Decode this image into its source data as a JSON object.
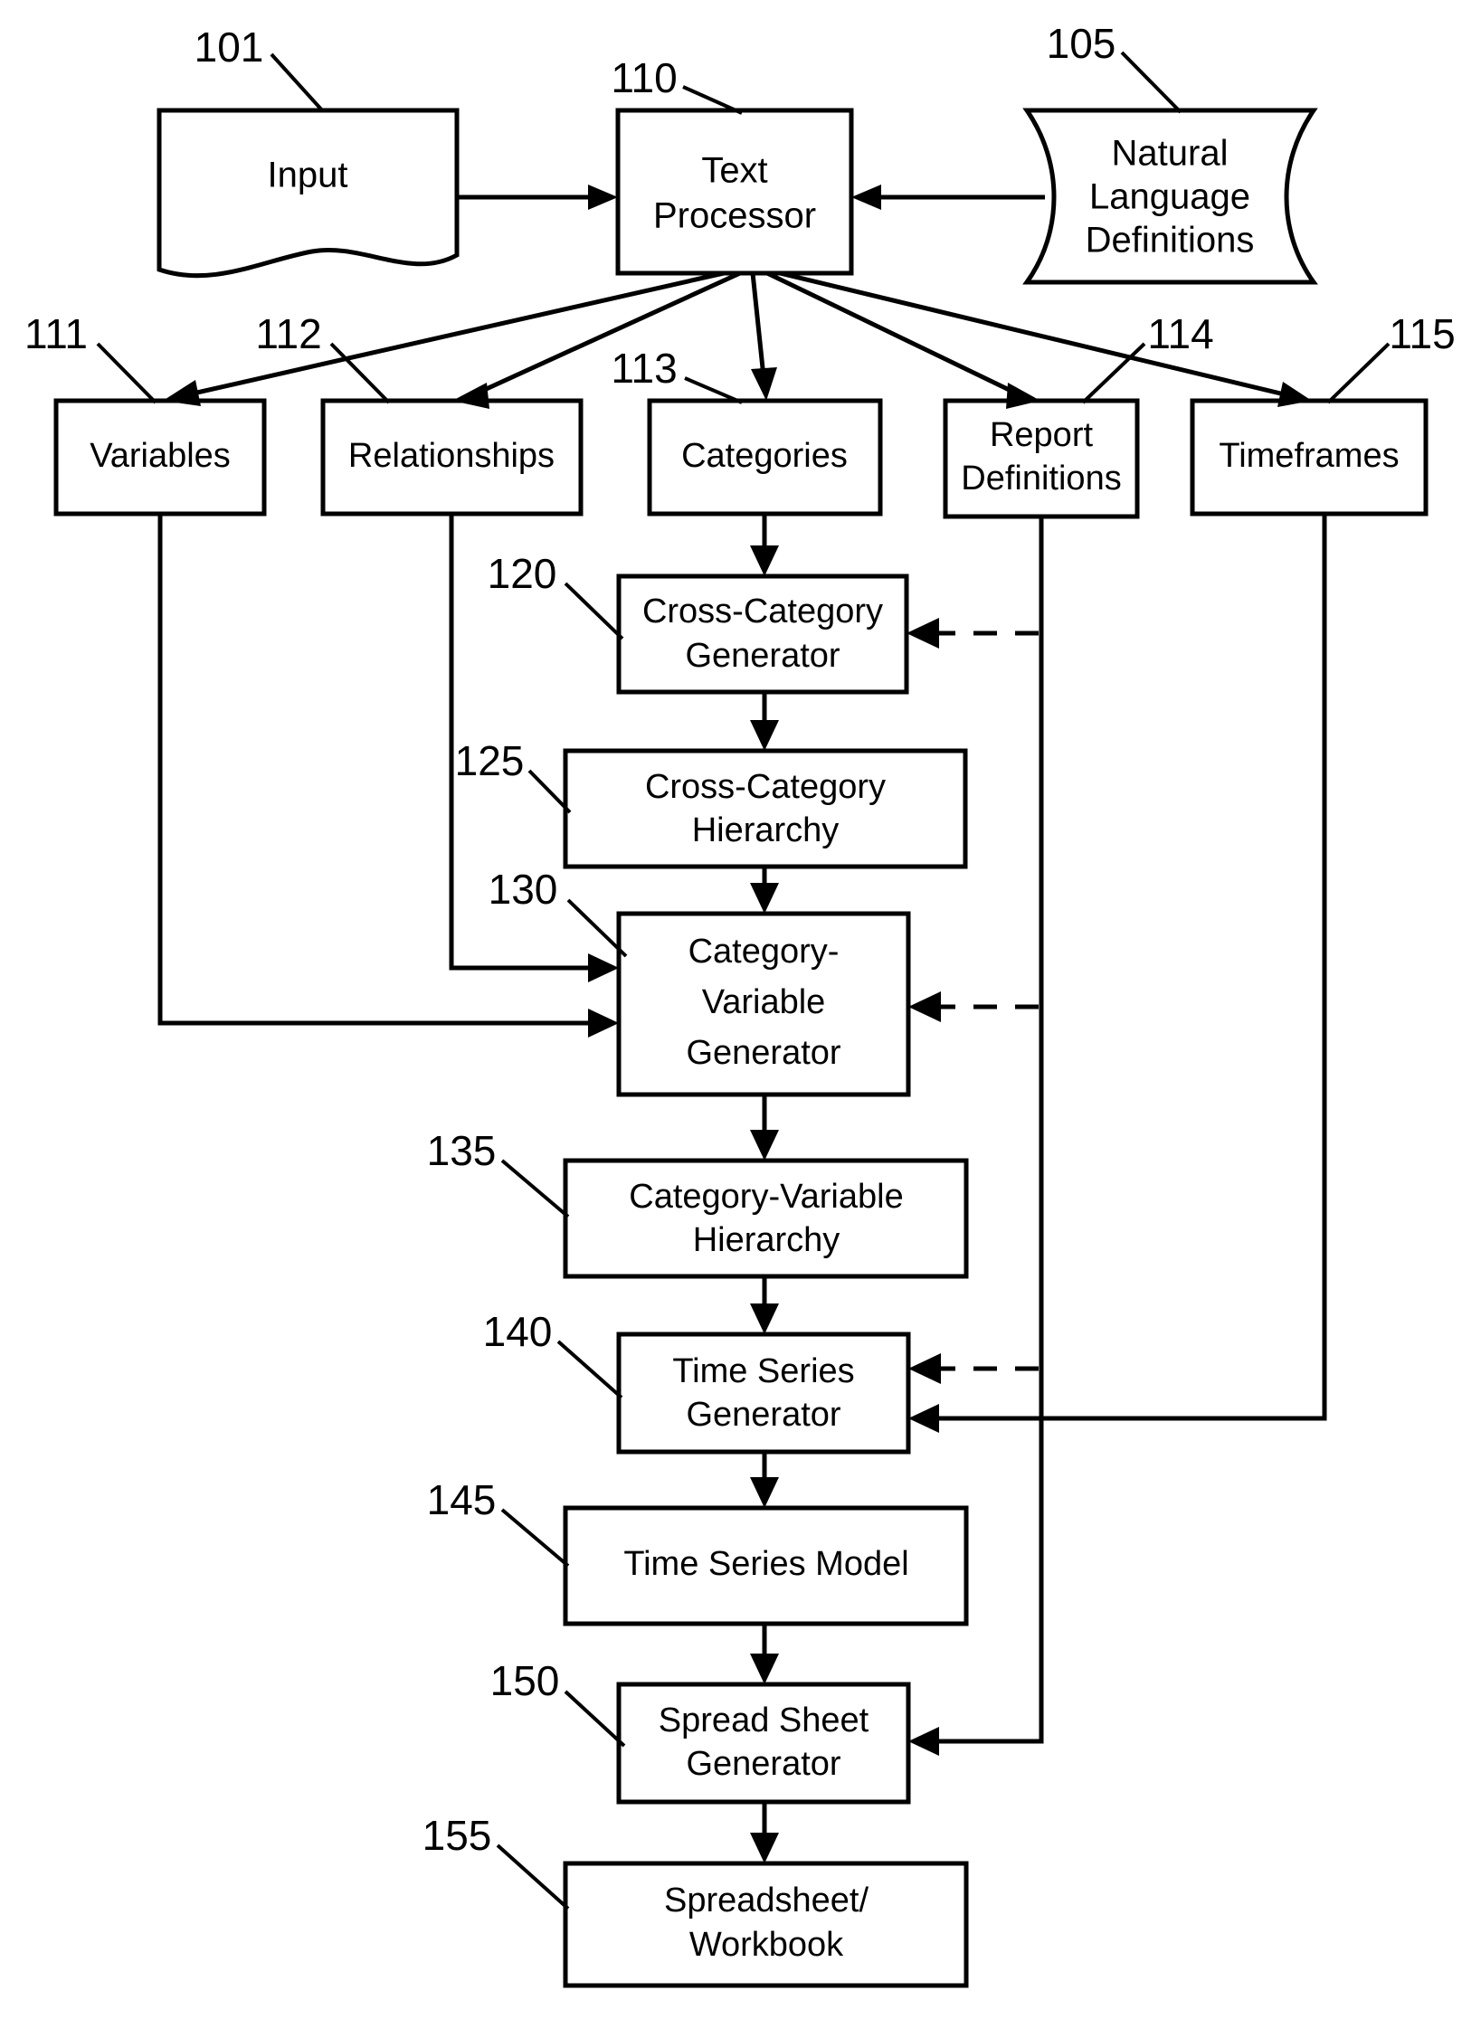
{
  "diagram": {
    "title": "Text Processor to Spreadsheet Generation Flowchart",
    "type": "patent-flowchart",
    "ink_color": "#000000",
    "background_color": "#ffffff",
    "nodes": [
      {
        "ref": "101",
        "label": "Input",
        "shape": "document"
      },
      {
        "ref": "110",
        "label": "Text Processor",
        "label_line1": "Text",
        "label_line2": "Processor",
        "shape": "rect"
      },
      {
        "ref": "105",
        "label": "Natural Language Definitions",
        "label_line1": "Natural",
        "label_line2": "Language",
        "label_line3": "Definitions",
        "shape": "tape"
      },
      {
        "ref": "111",
        "label": "Variables",
        "shape": "rect"
      },
      {
        "ref": "112",
        "label": "Relationships",
        "shape": "rect"
      },
      {
        "ref": "113",
        "label": "Categories",
        "shape": "rect"
      },
      {
        "ref": "114",
        "label": "Report Definitions",
        "label_line1": "Report",
        "label_line2": "Definitions",
        "shape": "rect"
      },
      {
        "ref": "115",
        "label": "Timeframes",
        "shape": "rect"
      },
      {
        "ref": "120",
        "label": "Cross-Category Generator",
        "label_line1": "Cross-Category",
        "label_line2": "Generator",
        "shape": "rect"
      },
      {
        "ref": "125",
        "label": "Cross-Category Hierarchy",
        "label_line1": "Cross-Category",
        "label_line2": "Hierarchy",
        "shape": "rect"
      },
      {
        "ref": "130",
        "label": "Category-Variable Generator",
        "label_line1": "Category-",
        "label_line2": "Variable",
        "label_line3": "Generator",
        "shape": "rect"
      },
      {
        "ref": "135",
        "label": "Category-Variable Hierarchy",
        "label_line1": "Category-Variable",
        "label_line2": "Hierarchy",
        "shape": "rect"
      },
      {
        "ref": "140",
        "label": "Time Series Generator",
        "label_line1": "Time Series",
        "label_line2": "Generator",
        "shape": "rect"
      },
      {
        "ref": "145",
        "label": "Time Series Model",
        "shape": "rect"
      },
      {
        "ref": "150",
        "label": "Spread Sheet Generator",
        "label_line1": "Spread Sheet",
        "label_line2": "Generator",
        "shape": "rect"
      },
      {
        "ref": "155",
        "label": "Spreadsheet/Workbook",
        "label_line1": "Spreadsheet/",
        "label_line2": "Workbook",
        "shape": "rect"
      }
    ],
    "edges": [
      {
        "from": "101",
        "to": "110",
        "style": "solid"
      },
      {
        "from": "105",
        "to": "110",
        "style": "solid"
      },
      {
        "from": "110",
        "to": "111",
        "style": "solid"
      },
      {
        "from": "110",
        "to": "112",
        "style": "solid"
      },
      {
        "from": "110",
        "to": "113",
        "style": "solid"
      },
      {
        "from": "110",
        "to": "114",
        "style": "solid"
      },
      {
        "from": "110",
        "to": "115",
        "style": "solid"
      },
      {
        "from": "113",
        "to": "120",
        "style": "solid"
      },
      {
        "from": "114",
        "to": "120",
        "style": "dashed"
      },
      {
        "from": "120",
        "to": "125",
        "style": "solid"
      },
      {
        "from": "125",
        "to": "130",
        "style": "solid"
      },
      {
        "from": "112",
        "to": "130",
        "style": "solid"
      },
      {
        "from": "111",
        "to": "130",
        "style": "solid"
      },
      {
        "from": "114",
        "to": "130",
        "style": "dashed"
      },
      {
        "from": "130",
        "to": "135",
        "style": "solid"
      },
      {
        "from": "135",
        "to": "140",
        "style": "solid"
      },
      {
        "from": "114",
        "to": "140",
        "style": "dashed"
      },
      {
        "from": "115",
        "to": "140",
        "style": "solid"
      },
      {
        "from": "140",
        "to": "145",
        "style": "solid"
      },
      {
        "from": "145",
        "to": "150",
        "style": "solid"
      },
      {
        "from": "114",
        "to": "150",
        "style": "solid"
      },
      {
        "from": "150",
        "to": "155",
        "style": "solid"
      }
    ]
  }
}
